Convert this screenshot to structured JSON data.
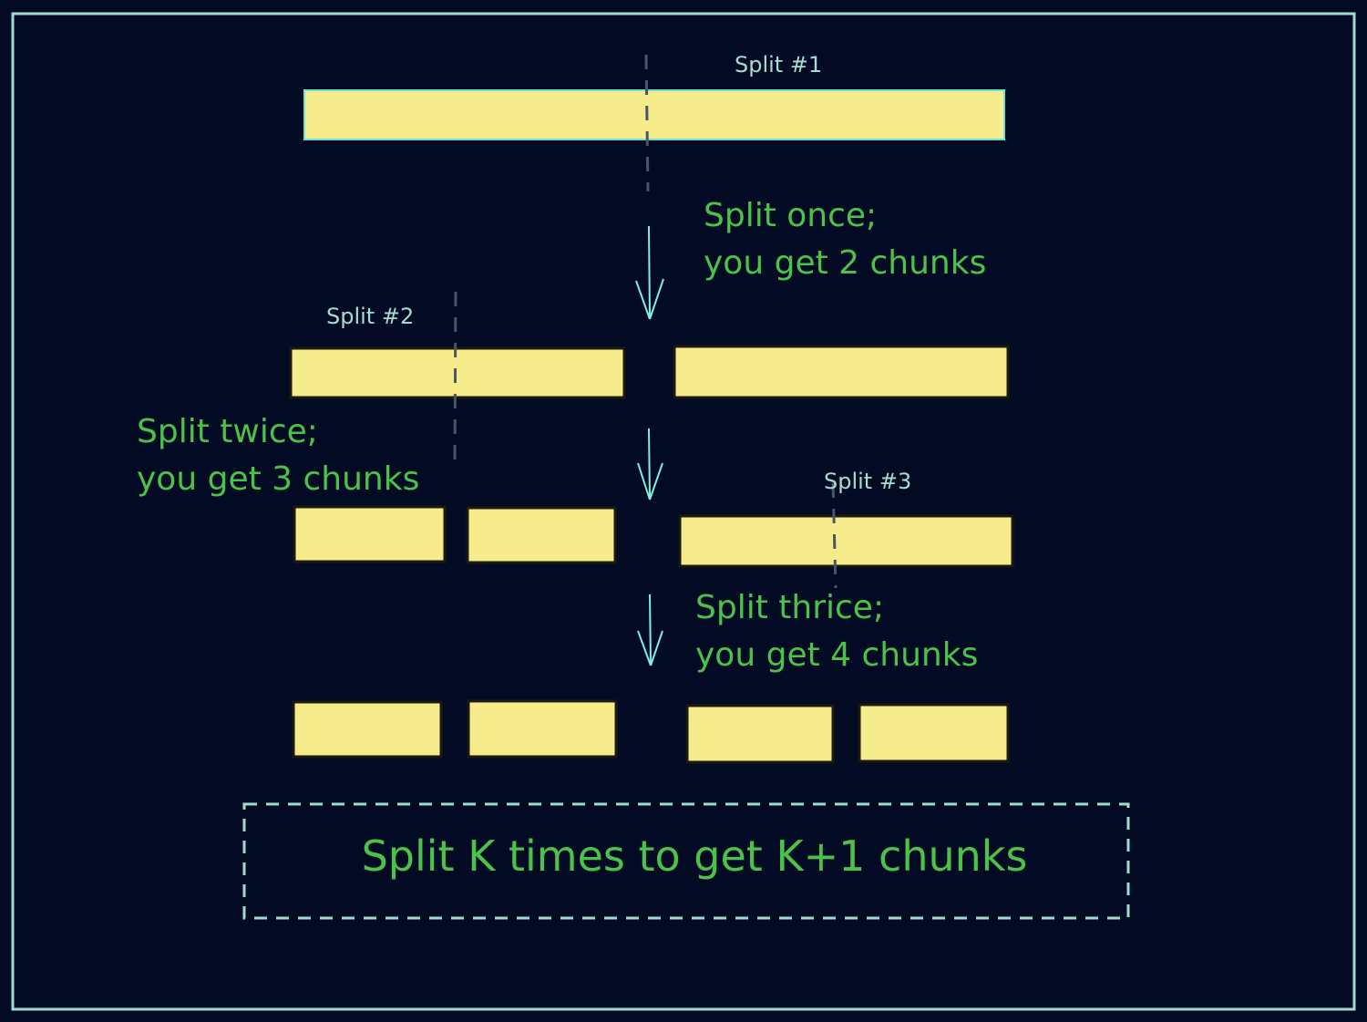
{
  "colors": {
    "background": "#020a24",
    "frame": "#a0dccc",
    "chunk_fill": "#f7ec8c",
    "chunk_stroke": "#1b1a0c",
    "first_bar_stroke": "#6fe3d2",
    "split_line": "#4a5566",
    "label": "#a8dcd0",
    "arrow": "#7ff0e0",
    "green_text": "#4cc24a",
    "summary_border": "#a0dccc"
  },
  "split_labels": [
    "Split #1",
    "Split #2",
    "Split #3"
  ],
  "step_captions": [
    {
      "line1": "Split once;",
      "line2": "you get 2 chunks"
    },
    {
      "line1": "Split twice;",
      "line2": "you get 3 chunks"
    },
    {
      "line1": "Split thrice;",
      "line2": "you get 4 chunks"
    }
  ],
  "rows": [
    {
      "chunks": 1,
      "splits": 0
    },
    {
      "chunks": 2,
      "splits": 1
    },
    {
      "chunks": 3,
      "splits": 2
    },
    {
      "chunks": 4,
      "splits": 3
    }
  ],
  "summary": "Split K times to get K+1 chunks"
}
